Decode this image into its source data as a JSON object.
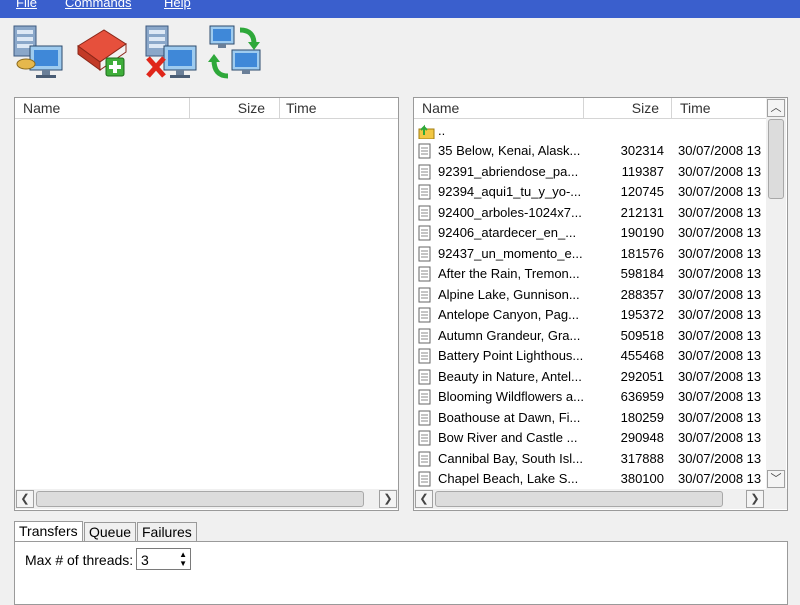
{
  "menu": [
    "File",
    "Commands",
    "Help"
  ],
  "toolbar": {
    "buttons": [
      {
        "name": "connect-server-button",
        "icon": "server-computer-icon"
      },
      {
        "name": "add-book-button",
        "icon": "book-add-icon"
      },
      {
        "name": "disconnect-server-button",
        "icon": "server-delete-icon"
      },
      {
        "name": "sync-button",
        "icon": "refresh-computers-icon"
      }
    ]
  },
  "left_pane": {
    "columns": {
      "name": "Name",
      "size": "Size",
      "time": "Time"
    },
    "rows": []
  },
  "right_pane": {
    "columns": {
      "name": "Name",
      "size": "Size",
      "time": "Time"
    },
    "up_row": "..",
    "rows": [
      {
        "name": "35 Below, Kenai, Alask...",
        "size": "302314",
        "time": "30/07/2008 13"
      },
      {
        "name": "92391_abriendose_pa...",
        "size": "119387",
        "time": "30/07/2008 13"
      },
      {
        "name": "92394_aqui1_tu_y_yo-...",
        "size": "120745",
        "time": "30/07/2008 13"
      },
      {
        "name": "92400_arboles-1024x7...",
        "size": "212131",
        "time": "30/07/2008 13"
      },
      {
        "name": "92406_atardecer_en_...",
        "size": "190190",
        "time": "30/07/2008 13"
      },
      {
        "name": "92437_un_momento_e...",
        "size": "181576",
        "time": "30/07/2008 13"
      },
      {
        "name": "After the Rain, Tremon...",
        "size": "598184",
        "time": "30/07/2008 13"
      },
      {
        "name": "Alpine Lake, Gunnison...",
        "size": "288357",
        "time": "30/07/2008 13"
      },
      {
        "name": "Antelope Canyon, Pag...",
        "size": "195372",
        "time": "30/07/2008 13"
      },
      {
        "name": "Autumn Grandeur, Gra...",
        "size": "509518",
        "time": "30/07/2008 13"
      },
      {
        "name": "Battery Point Lighthous...",
        "size": "455468",
        "time": "30/07/2008 13"
      },
      {
        "name": "Beauty in Nature, Antel...",
        "size": "292051",
        "time": "30/07/2008 13"
      },
      {
        "name": "Blooming Wildflowers a...",
        "size": "636959",
        "time": "30/07/2008 13"
      },
      {
        "name": "Boathouse at Dawn, Fi...",
        "size": "180259",
        "time": "30/07/2008 13"
      },
      {
        "name": "Bow River and Castle ...",
        "size": "290948",
        "time": "30/07/2008 13"
      },
      {
        "name": "Cannibal Bay, South Isl...",
        "size": "317888",
        "time": "30/07/2008 13"
      },
      {
        "name": "Chapel Beach, Lake S...",
        "size": "380100",
        "time": "30/07/2008 13"
      }
    ]
  },
  "tabs": [
    "Transfers",
    "Queue",
    "Failures"
  ],
  "transfers": {
    "threads_label": "Max # of threads:",
    "threads_value": "3"
  }
}
